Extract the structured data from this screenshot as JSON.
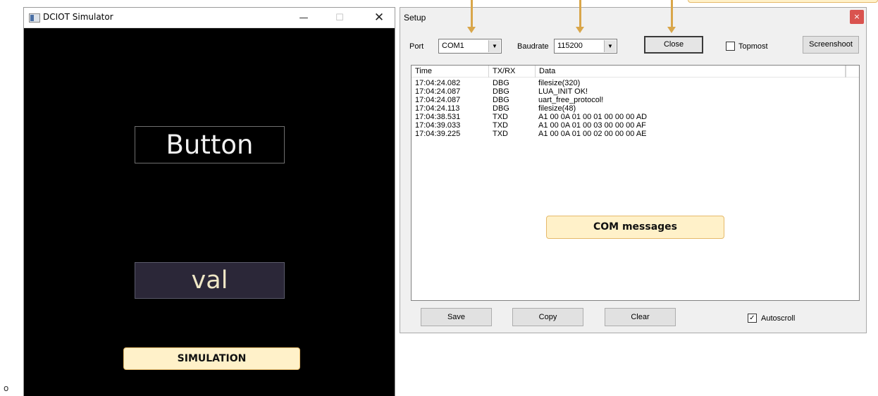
{
  "stray_char": "o",
  "simulator": {
    "title": "DCIOT Simulator",
    "controls": {
      "minimize": "—",
      "maximize": "☐",
      "close": "✕"
    },
    "button_label": "Button",
    "val_label": "val",
    "caption": "SIMULATION"
  },
  "setup": {
    "title": "Setup",
    "close_glyph": "×",
    "port_label": "Port",
    "port_value": "COM1",
    "baudrate_label": "Baudrate",
    "baudrate_value": "115200",
    "close_button": "Close",
    "topmost_label": "Topmost",
    "topmost_checked": false,
    "screenshoot_button": "Screenshoot",
    "columns": [
      "Time",
      "TX/RX",
      "Data"
    ],
    "rows": [
      {
        "time": "17:04:24.082",
        "txrx": "DBG",
        "data": "filesize(320)"
      },
      {
        "time": "17:04:24.087",
        "txrx": "DBG",
        "data": "LUA_INIT OK!"
      },
      {
        "time": "17:04:24.087",
        "txrx": "DBG",
        "data": "uart_free_protocol!"
      },
      {
        "time": "17:04:24.113",
        "txrx": "DBG",
        "data": "filesize(48)"
      },
      {
        "time": "17:04:38.531",
        "txrx": "TXD",
        "data": "A1 00 0A 01 00 01 00 00 00 AD"
      },
      {
        "time": "17:04:39.033",
        "txrx": "TXD",
        "data": "A1 00 0A 01 00 03 00 00 00 AF"
      },
      {
        "time": "17:04:39.225",
        "txrx": "TXD",
        "data": "A1 00 0A 01 00 02 00 00 00 AE"
      }
    ],
    "com_caption": "COM messages",
    "save_button": "Save",
    "copy_button": "Copy",
    "clear_button": "Clear",
    "autoscroll_label": "Autoscroll",
    "autoscroll_checked": true,
    "check_glyph": "✓"
  },
  "colors": {
    "callout_bg": "#fff1c9",
    "callout_border": "#e5b96a",
    "arrow": "#d9a64a",
    "val_bg": "#2b2738"
  }
}
